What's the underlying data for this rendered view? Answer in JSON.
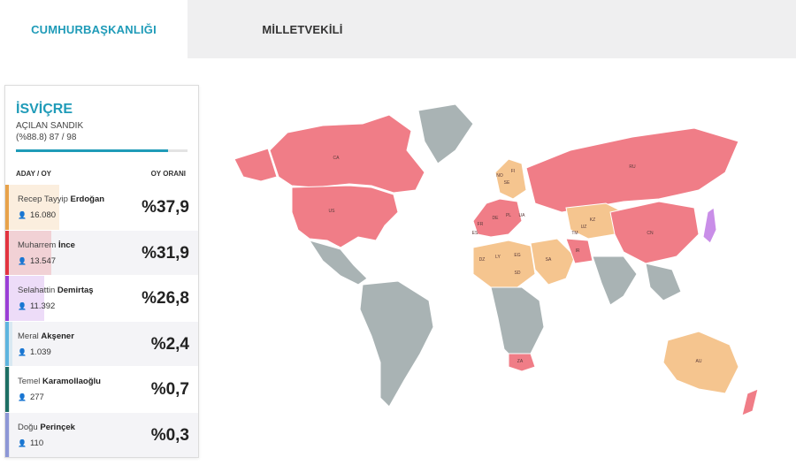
{
  "tabs": [
    {
      "label": "CUMHURBAŞKANLIĞI",
      "active": true
    },
    {
      "label": "MİLLETVEKİLİ",
      "active": false
    }
  ],
  "panel": {
    "country": "İSVİÇRE",
    "box_label": "AÇILAN SANDIK",
    "box_count": "(%88.8) 87 / 98",
    "progress_fraction": 0.888,
    "col_candidate": "ADAY / OY",
    "col_rate": "OY ORANI",
    "candidates": [
      {
        "first": "Recep Tayyip",
        "last": "Erdoğan",
        "votes": "16.080",
        "pct": "%37,9",
        "share": 37.9,
        "color": "#e8a24a"
      },
      {
        "first": "Muharrem",
        "last": "İnce",
        "votes": "13.547",
        "pct": "%31,9",
        "share": 31.9,
        "color": "#e2343f"
      },
      {
        "first": "Selahattin",
        "last": "Demirtaş",
        "votes": "11.392",
        "pct": "%26,8",
        "share": 26.8,
        "color": "#9a3fd6"
      },
      {
        "first": "Meral",
        "last": "Akşener",
        "votes": "1.039",
        "pct": "%2,4",
        "share": 2.4,
        "color": "#5eb5df"
      },
      {
        "first": "Temel",
        "last": "Karamollaoğlu",
        "votes": "277",
        "pct": "%0,7",
        "share": 0.7,
        "color": "#1c6e63"
      },
      {
        "first": "Doğu",
        "last": "Perinçek",
        "votes": "110",
        "pct": "%0,3",
        "share": 0.3,
        "color": "#8d97d6"
      }
    ]
  },
  "map": {
    "colors": {
      "erdogan": "#f5c58f",
      "ince": "#f07d87",
      "demirtas": "#c98ee8",
      "none": "#a9b3b4"
    },
    "labels": [
      "CA",
      "US",
      "RU",
      "CN",
      "KZ",
      "AU",
      "ZA",
      "DZ",
      "EG",
      "SA",
      "LY",
      "SD",
      "FR",
      "ES",
      "DE",
      "PL",
      "UA",
      "FI",
      "NO",
      "SE",
      "IR",
      "TM",
      "UZ"
    ]
  },
  "icons": {
    "user": "user-icon"
  }
}
